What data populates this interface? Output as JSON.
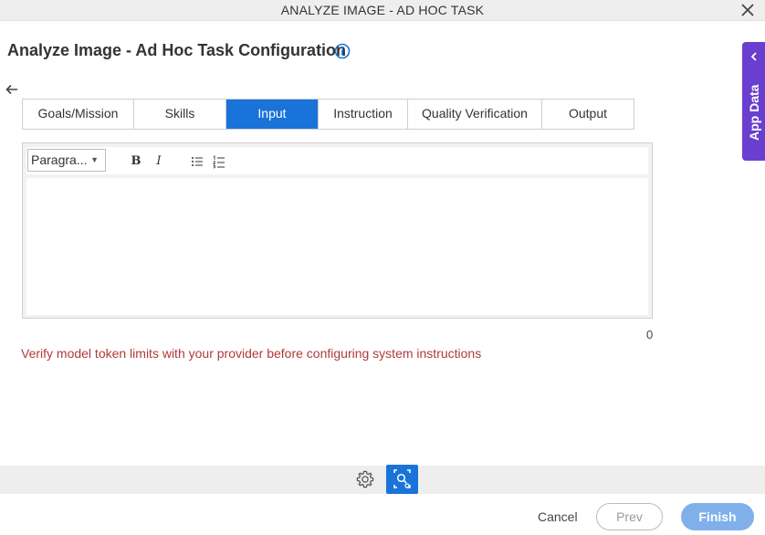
{
  "window": {
    "title": "ANALYZE IMAGE - AD HOC TASK"
  },
  "page": {
    "heading": "Analyze Image - Ad Hoc Task Configuration"
  },
  "tabs": [
    {
      "label": "Goals/Mission"
    },
    {
      "label": "Skills"
    },
    {
      "label": "Input"
    },
    {
      "label": "Instruction"
    },
    {
      "label": "Quality Verification"
    },
    {
      "label": "Output"
    }
  ],
  "active_tab": "Input",
  "editor": {
    "paragraph_select": "Paragra...",
    "bold_label": "B",
    "italic_label": "I",
    "content": "",
    "char_count": "0"
  },
  "warning": "Verify model token limits with your provider before configuring system instructions",
  "app_data": {
    "label": "App Data"
  },
  "footer": {
    "cancel": "Cancel",
    "prev": "Prev",
    "finish": "Finish"
  },
  "icons": {
    "close": "close-icon",
    "info": "info-icon",
    "back": "back-arrow-icon",
    "settings": "gear-icon",
    "scan": "image-scan-icon",
    "chevron": "chevron-left-icon"
  },
  "colors": {
    "accent": "#1a73d9",
    "app_data": "#6a3fd0",
    "warning": "#b03a3a",
    "finish_disabled": "#7fb0ea"
  }
}
